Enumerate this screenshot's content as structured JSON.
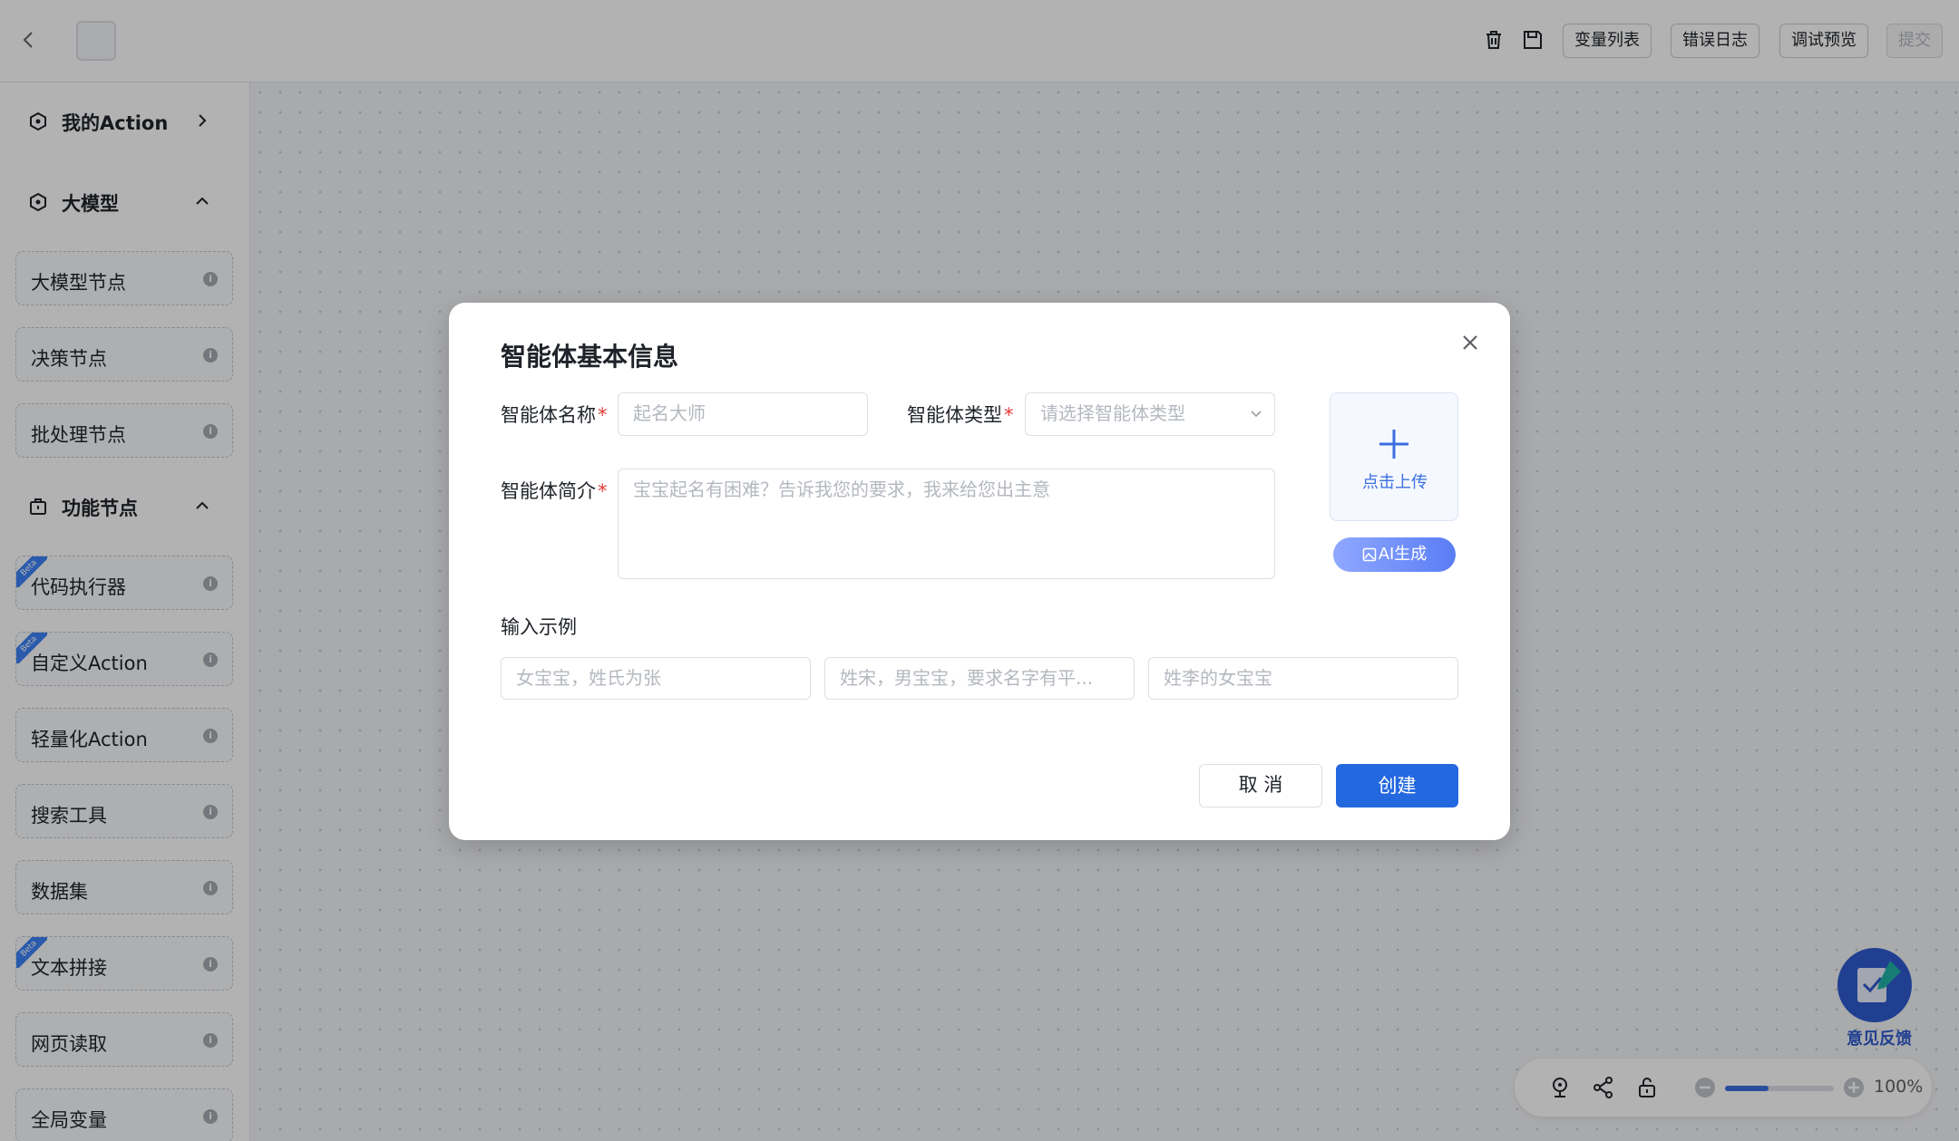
{
  "header": {
    "buttons": [
      "变量列表",
      "错误日志",
      "调试预览"
    ],
    "submit_label": "提交"
  },
  "sidebar": {
    "my_action": {
      "label": "我的Action"
    },
    "llm_section": {
      "label": "大模型",
      "items": [
        "大模型节点",
        "决策节点",
        "批处理节点"
      ]
    },
    "func_section": {
      "label": "功能节点",
      "items": [
        {
          "label": "代码执行器",
          "beta": true
        },
        {
          "label": "自定义Action",
          "beta": true
        },
        {
          "label": "轻量化Action",
          "beta": false
        },
        {
          "label": "搜索工具",
          "beta": false
        },
        {
          "label": "数据集",
          "beta": false
        },
        {
          "label": "文本拼接",
          "beta": true
        },
        {
          "label": "网页读取",
          "beta": false
        },
        {
          "label": "全局变量",
          "beta": false
        }
      ]
    },
    "beta_text": "Beta"
  },
  "modal": {
    "title": "智能体基本信息",
    "name_label": "智能体名称",
    "name_placeholder": "起名大师",
    "type_label": "智能体类型",
    "type_placeholder": "请选择智能体类型",
    "desc_label": "智能体简介",
    "desc_placeholder": "宝宝起名有困难？告诉我您的要求，我来给您出主意",
    "upload_label": "点击上传",
    "ai_button": "AI生成",
    "examples_label": "输入示例",
    "examples": [
      "女宝宝，姓氏为张",
      "姓宋，男宝宝，要求名字有平...",
      "姓李的女宝宝"
    ],
    "cancel_label": "取 消",
    "create_label": "创建",
    "required_mark": "*"
  },
  "feedback": {
    "label": "意见反馈"
  },
  "zoom": {
    "level": "100%",
    "slider_fraction": 0.4
  },
  "colors": {
    "primary": "#2468e0",
    "required": "#e53935",
    "overlay": "rgba(0,0,0,0.30)"
  }
}
